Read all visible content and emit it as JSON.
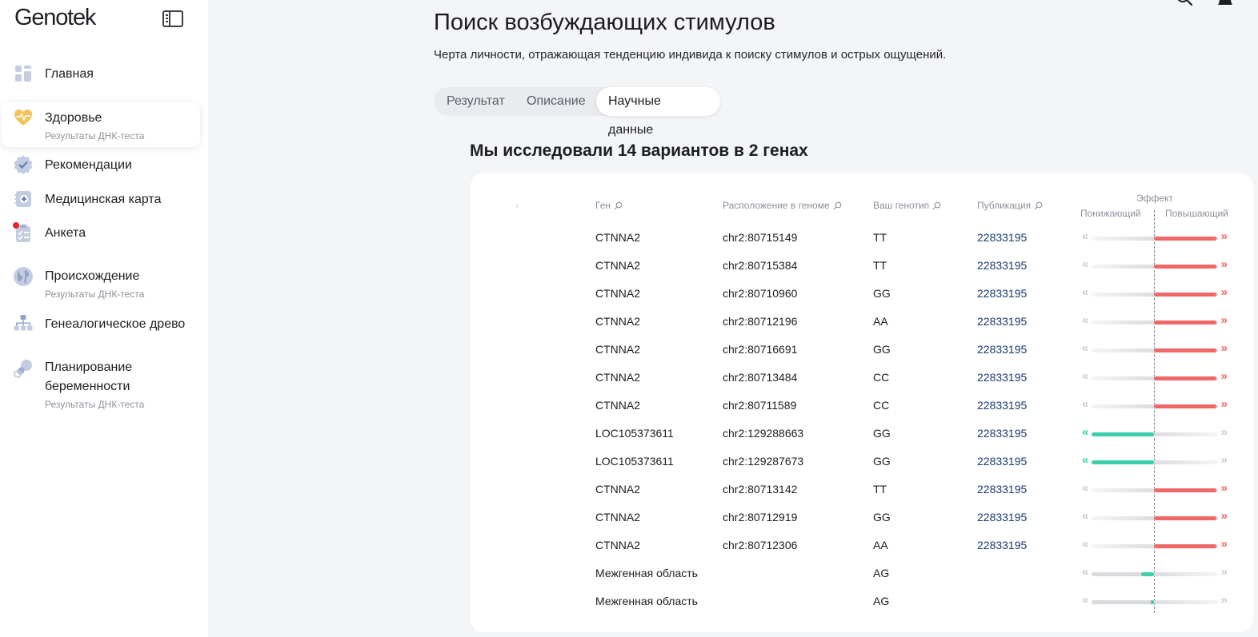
{
  "app": {
    "logo": "Genotek"
  },
  "sidebar": {
    "items": [
      {
        "key": "home",
        "label": "Главная",
        "sub": "",
        "icon": "grid-icon"
      },
      {
        "key": "health",
        "label": "Здоровье",
        "sub": "Результаты ДНК-теста",
        "icon": "heart-pulse-icon",
        "active": true
      },
      {
        "key": "recs",
        "label": "Рекомендации",
        "sub": "",
        "icon": "badge-check-icon"
      },
      {
        "key": "medcard",
        "label": "Медицинская карта",
        "sub": "",
        "icon": "medical-card-icon"
      },
      {
        "key": "survey",
        "label": "Анкета",
        "sub": "",
        "icon": "clipboard-icon",
        "badge": true
      },
      {
        "key": "origin",
        "label": "Происхождение",
        "sub": "Результаты ДНК-теста",
        "icon": "globe-icon"
      },
      {
        "key": "tree",
        "label": "Генеалогическое древо",
        "sub": "",
        "icon": "tree-icon"
      },
      {
        "key": "pregnancy",
        "label": "Планирование беременности",
        "label_lines": [
          "Планирование",
          "беременности"
        ],
        "sub": "Результаты ДНК-теста",
        "icon": "pacifier-icon"
      }
    ]
  },
  "page": {
    "title": "Поиск возбуждающих стимулов",
    "description": "Черта личности, отражающая тенденцию индивида к поиску стимулов и острых ощущений.",
    "tabs": [
      {
        "label": "Результат",
        "active": false
      },
      {
        "label": "Описание",
        "active": false
      },
      {
        "label": "Научные данные",
        "active": true
      }
    ],
    "section_title": "Мы исследовали 14 вариантов в 2 генах"
  },
  "table": {
    "columns": {
      "gene": "Ген",
      "location": "Расположение в геноме",
      "genotype": "Ваш генотип",
      "publication": "Публикация",
      "effect": "Эффект",
      "effect_low": "Понижающий",
      "effect_high": "Повышающий"
    },
    "colors": {
      "increase": "#f06767",
      "decrease": "#3ccfad",
      "inactive_arrow": "#c9ccd1"
    },
    "rows": [
      {
        "gene": "CTNNA2",
        "location": "chr2:80715149",
        "genotype": "TT",
        "publication": "22833195",
        "direction": "up",
        "magnitude": 1.0
      },
      {
        "gene": "CTNNA2",
        "location": "chr2:80715384",
        "genotype": "TT",
        "publication": "22833195",
        "direction": "up",
        "magnitude": 1.0
      },
      {
        "gene": "CTNNA2",
        "location": "chr2:80710960",
        "genotype": "GG",
        "publication": "22833195",
        "direction": "up",
        "magnitude": 1.0
      },
      {
        "gene": "CTNNA2",
        "location": "chr2:80712196",
        "genotype": "AA",
        "publication": "22833195",
        "direction": "up",
        "magnitude": 1.0
      },
      {
        "gene": "CTNNA2",
        "location": "chr2:80716691",
        "genotype": "GG",
        "publication": "22833195",
        "direction": "up",
        "magnitude": 1.0
      },
      {
        "gene": "CTNNA2",
        "location": "chr2:80713484",
        "genotype": "CC",
        "publication": "22833195",
        "direction": "up",
        "magnitude": 1.0
      },
      {
        "gene": "CTNNA2",
        "location": "chr2:80711589",
        "genotype": "CC",
        "publication": "22833195",
        "direction": "up",
        "magnitude": 1.0
      },
      {
        "gene": "LOC105373611",
        "location": "chr2:129288663",
        "genotype": "GG",
        "publication": "22833195",
        "direction": "down",
        "magnitude": 1.0
      },
      {
        "gene": "LOC105373611",
        "location": "chr2:129287673",
        "genotype": "GG",
        "publication": "22833195",
        "direction": "down",
        "magnitude": 1.0
      },
      {
        "gene": "CTNNA2",
        "location": "chr2:80713142",
        "genotype": "TT",
        "publication": "22833195",
        "direction": "up",
        "magnitude": 1.0
      },
      {
        "gene": "CTNNA2",
        "location": "chr2:80712919",
        "genotype": "GG",
        "publication": "22833195",
        "direction": "up",
        "magnitude": 1.0
      },
      {
        "gene": "CTNNA2",
        "location": "chr2:80712306",
        "genotype": "AA",
        "publication": "22833195",
        "direction": "up",
        "magnitude": 1.0
      },
      {
        "gene": "Межгенная область",
        "location": "",
        "genotype": "AG",
        "publication": "",
        "direction": "down",
        "magnitude": 0.2
      },
      {
        "gene": "Межгенная область",
        "location": "",
        "genotype": "AG",
        "publication": "",
        "direction": "down",
        "magnitude": 0.05
      }
    ]
  }
}
